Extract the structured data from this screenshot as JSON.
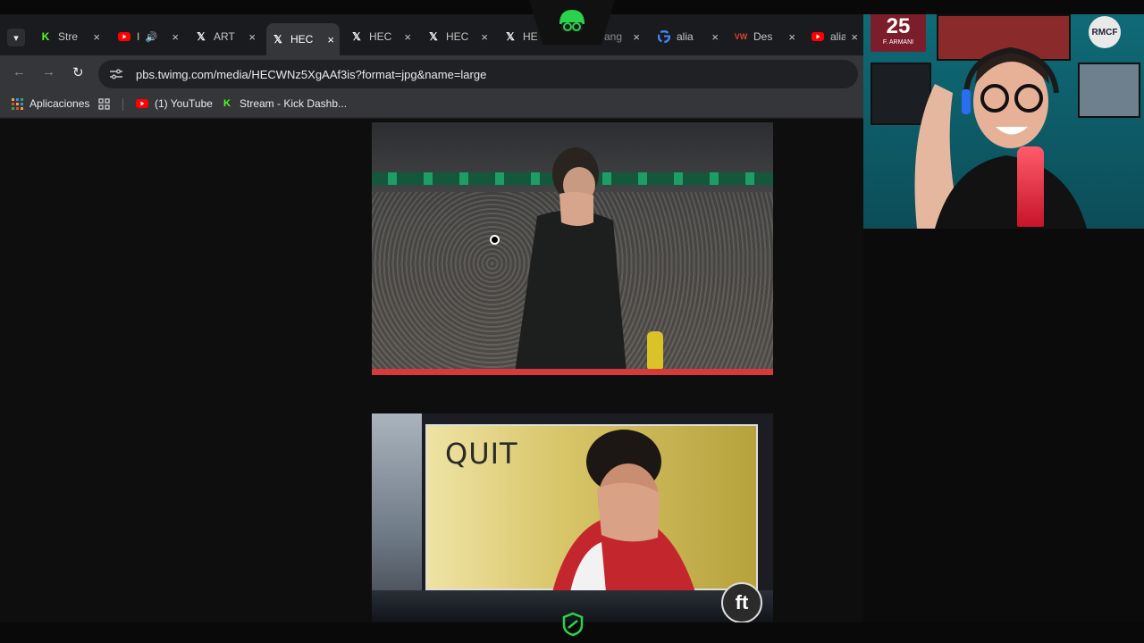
{
  "browser": {
    "tabs": [
      {
        "label": "Stre",
        "favicon": "kick-icon",
        "active": false
      },
      {
        "label": "I",
        "favicon": "youtube-icon",
        "active": false,
        "audio": true
      },
      {
        "label": "ART",
        "favicon": "x-icon",
        "active": false
      },
      {
        "label": "HEC",
        "favicon": "x-icon",
        "active": true
      },
      {
        "label": "HEC",
        "favicon": "x-icon",
        "active": false
      },
      {
        "label": "HEC",
        "favicon": "x-icon",
        "active": false
      },
      {
        "label": "HE",
        "favicon": "x-icon",
        "active": false
      },
      {
        "label": "ang",
        "favicon": "none",
        "active": false
      },
      {
        "label": "alia",
        "favicon": "google-icon",
        "active": false
      },
      {
        "label": "Des",
        "favicon": "wm-icon",
        "active": false
      },
      {
        "label": "alia",
        "favicon": "youtube-icon",
        "active": false
      }
    ],
    "close_glyph": "×",
    "toolbar": {
      "back": "←",
      "forward": "→",
      "reload": "↻",
      "url": "pbs.twimg.com/media/HECWNz5XgAAf3is?format=jpg&name=large"
    },
    "bookmarks": [
      {
        "label": "Aplicaciones",
        "icon": "apps-grid-icon"
      },
      {
        "label": "",
        "icon": "grid-icon"
      },
      {
        "label": "(1) YouTube",
        "icon": "youtube-icon"
      },
      {
        "label": "Stream - Kick Dashb...",
        "icon": "kick-icon"
      }
    ]
  },
  "content": {
    "image2_caption": "QUIT",
    "image2_logo": "ft"
  },
  "webcam": {
    "jersey_number": "25",
    "jersey_name": "F. ARMANI"
  },
  "colors": {
    "accent_green": "#53fc18",
    "youtube_red": "#ff0000",
    "tab_active": "#35363a"
  }
}
